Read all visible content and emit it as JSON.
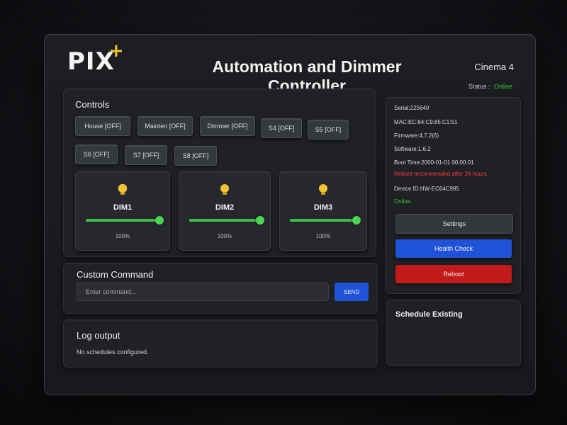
{
  "logo": {
    "text": "PIX",
    "plus": "+"
  },
  "header": {
    "title": "Automation and Dimmer Controller",
    "cinema": "Cinema 4",
    "status_label": "Status :",
    "status_value": "Online"
  },
  "controls": {
    "title": "Controls",
    "switches": [
      {
        "label": "House [OFF]"
      },
      {
        "label": "Mainten [OFF]"
      },
      {
        "label": "Dimmer [OFF]"
      },
      {
        "label": "S4 [OFF]"
      },
      {
        "label": "S5 [OFF]"
      },
      {
        "label": "S6 [OFF]"
      },
      {
        "label": "S7 [OFF]"
      },
      {
        "label": "S8 [OFF]"
      }
    ],
    "dimmers": [
      {
        "label": "DIM1",
        "percent_text": "100%",
        "level": 1.0
      },
      {
        "label": "DIM2",
        "percent_text": "100%",
        "level": 1.0
      },
      {
        "label": "DIM3",
        "percent_text": "100%",
        "level": 1.0
      }
    ]
  },
  "custom_command": {
    "title": "Custom Command",
    "placeholder": "Enter command...",
    "send_label": "SEND"
  },
  "log": {
    "title": "Log output",
    "message": "No schedules configured."
  },
  "device": {
    "serial": "Serial:225640",
    "mac": "MAC:EC:64:C9:85:C1:51",
    "firmware": "Firmware:4.7.2(6)",
    "software": "Software:1.6.2",
    "boot_time": "Boot Time:2000-01-01 00:00:01",
    "reboot_warning": "Reboot recommended after 24 hours.",
    "device_id": "Device ID:HW-EC64C985",
    "online": "Online."
  },
  "actions": {
    "settings_label": "Settings",
    "health_check_label": "Health Check",
    "reboot_label": "Reboot"
  },
  "schedule": {
    "title": "Schedule Existing"
  },
  "colors": {
    "accent_blue": "#1f52d6",
    "reboot_red": "#c01a1a",
    "online_green": "#35c73f",
    "warning_red": "#ff3b3b"
  }
}
